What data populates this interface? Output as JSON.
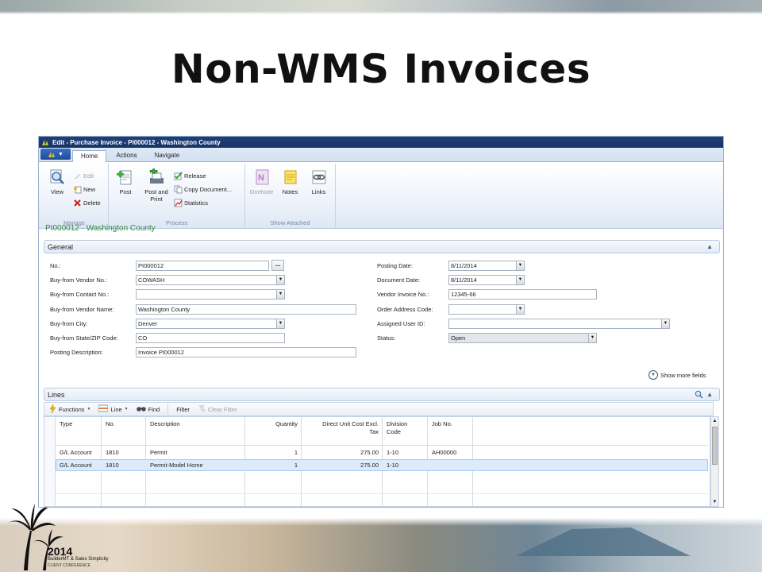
{
  "slide": {
    "title": "Non-WMS Invoices",
    "logo": {
      "year": "2014",
      "line1": "BuilderMT & Sales Simplicity",
      "line2": "CLIENT CONFERENCE"
    }
  },
  "window": {
    "title": "Edit - Purchase Invoice - PI000012 - Washington County",
    "tabs": [
      "Home",
      "Actions",
      "Navigate"
    ],
    "active_tab": "Home"
  },
  "ribbon": {
    "manage": {
      "label": "Manage",
      "view": "View",
      "edit": "Edit",
      "new": "New",
      "delete": "Delete"
    },
    "process": {
      "label": "Process",
      "post": "Post",
      "post_and_print_1": "Post and",
      "post_and_print_2": "Print",
      "release": "Release",
      "copy_document": "Copy Document...",
      "statistics": "Statistics"
    },
    "show_attached": {
      "label": "Show Attached",
      "onenote": "OneNote",
      "notes": "Notes",
      "links": "Links"
    }
  },
  "record_title": "PI000012 · Washington County",
  "general": {
    "tab_label": "General",
    "left": [
      {
        "label": "No.:",
        "value": "PI000012"
      },
      {
        "label": "Buy-from Vendor No.:",
        "value": "COWASH"
      },
      {
        "label": "Buy-from Contact No.:",
        "value": ""
      },
      {
        "label": "Buy-from Vendor Name:",
        "value": "Washington County"
      },
      {
        "label": "Buy-from City:",
        "value": "Denver"
      },
      {
        "label": "Buy-from State/ZIP Code:",
        "value": "CO"
      },
      {
        "label": "Posting Description:",
        "value": "Invoice PI000012"
      }
    ],
    "right": [
      {
        "label": "Posting Date:",
        "value": "8/11/2014"
      },
      {
        "label": "Document Date:",
        "value": "8/11/2014"
      },
      {
        "label": "Vendor Invoice No.:",
        "value": "12345-66"
      },
      {
        "label": "Order Address Code:",
        "value": ""
      },
      {
        "label": "Assigned User ID:",
        "value": ""
      },
      {
        "label": "Status:",
        "value": "Open"
      }
    ],
    "ellipsis": "...",
    "show_more": "Show more fields"
  },
  "lines": {
    "tab_label": "Lines",
    "toolbar": {
      "functions": "Functions",
      "line": "Line",
      "find": "Find",
      "filter": "Filter",
      "clear_filter": "Clear Filter"
    },
    "headers": {
      "type": "Type",
      "no": "No.",
      "description": "Description",
      "quantity": "Quantity",
      "cost_1": "Direct Unit Cost Excl.",
      "cost_2": "Tax",
      "division_1": "Division",
      "division_2": "Code",
      "job_no": "Job No."
    },
    "rows": [
      {
        "type": "G/L Account",
        "no": "1810",
        "description": "Permit",
        "quantity": "1",
        "cost": "275.00",
        "division": "1-10",
        "job_no": "AH00000"
      },
      {
        "type": "G/L Account",
        "no": "1810",
        "description": "Permit-Model Home",
        "quantity": "1",
        "cost": "275.00",
        "division": "1-10",
        "job_no": ""
      }
    ]
  },
  "colors": {
    "title_bar": "#1f3f79",
    "record_title": "#2e8a3a",
    "selected_row": "#dcebfa"
  }
}
